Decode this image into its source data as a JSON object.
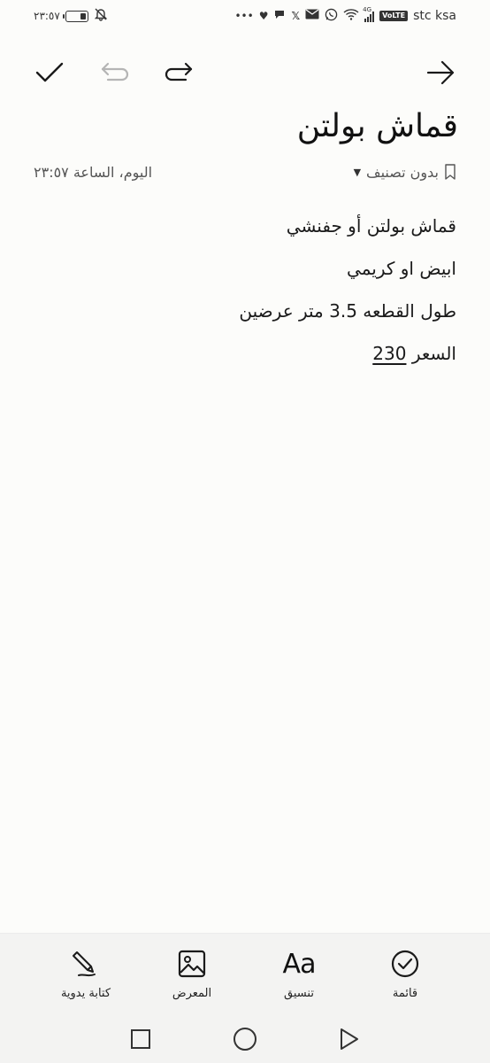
{
  "status_bar": {
    "time": "٢٣:٥٧",
    "carrier": "stc ksa",
    "volte": "VoLTE",
    "network": "4G",
    "battery_level": 0.3,
    "icons": [
      "battery-icon",
      "mute-icon",
      "more-icon",
      "heart-icon",
      "chat-icon",
      "x-icon",
      "mail-icon",
      "whatsapp-icon",
      "wifi-icon",
      "signal-icon"
    ]
  },
  "toolbar": {
    "save_icon": "check-icon",
    "undo_icon": "undo-icon",
    "redo_icon": "redo-icon",
    "back_icon": "arrow-right-icon"
  },
  "note": {
    "title": "قماش بولتن",
    "category": "بدون تصنيف",
    "timestamp": "اليوم، الساعة ٢٣:٥٧",
    "lines": [
      "قماش بولتن أو جفنشي",
      "ابيض او كريمي",
      "طول القطعه 3.5 متر عرضين"
    ],
    "price_label": "السعر",
    "price_value": "230"
  },
  "bottom_tools": {
    "list": "قائمة",
    "format": "تنسيق",
    "format_glyph": "Aa",
    "gallery": "المعرض",
    "handwriting": "كتابة يدوية"
  },
  "colors": {
    "background": "#fcfcfa",
    "panel": "#f3f3f2",
    "text": "#1a1a1a",
    "muted": "#555555",
    "disabled": "#b5b5b5"
  }
}
